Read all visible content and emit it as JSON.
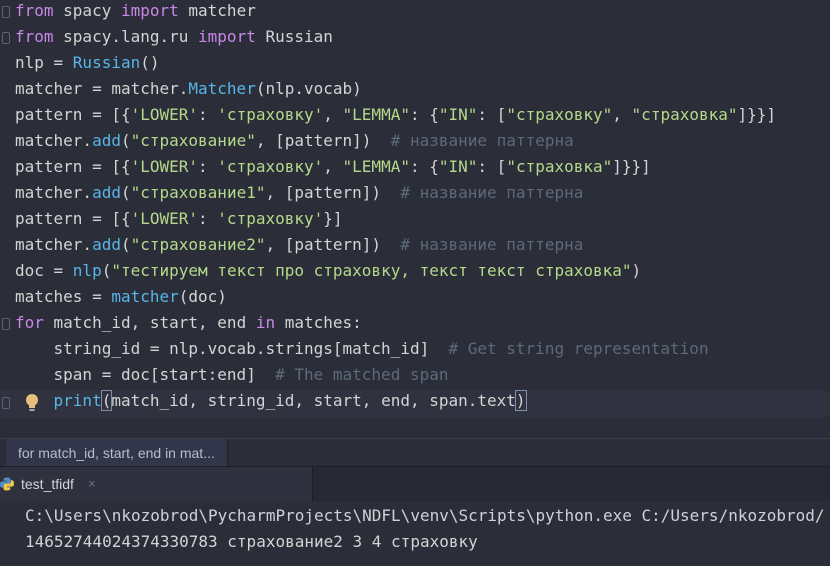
{
  "editor": {
    "lines": [
      [
        {
          "t": "from",
          "c": "kw"
        },
        {
          "t": " spacy ",
          "c": "nm"
        },
        {
          "t": "import",
          "c": "kw"
        },
        {
          "t": " matcher",
          "c": "nm"
        }
      ],
      [
        {
          "t": "from",
          "c": "kw"
        },
        {
          "t": " spacy.lang.ru ",
          "c": "nm"
        },
        {
          "t": "import",
          "c": "kw"
        },
        {
          "t": " Russian",
          "c": "nm"
        }
      ],
      [
        {
          "t": "nlp = ",
          "c": "nm"
        },
        {
          "t": "Russian",
          "c": "fn"
        },
        {
          "t": "()",
          "c": "nm"
        }
      ],
      [
        {
          "t": "matcher = matcher.",
          "c": "nm"
        },
        {
          "t": "Matcher",
          "c": "fn"
        },
        {
          "t": "(nlp.vocab)",
          "c": "nm"
        }
      ],
      [
        {
          "t": "pattern = [{",
          "c": "nm"
        },
        {
          "t": "'LOWER'",
          "c": "st"
        },
        {
          "t": ": ",
          "c": "nm"
        },
        {
          "t": "'страховку'",
          "c": "st"
        },
        {
          "t": ", ",
          "c": "nm"
        },
        {
          "t": "\"LEMMA\"",
          "c": "st"
        },
        {
          "t": ": {",
          "c": "nm"
        },
        {
          "t": "\"IN\"",
          "c": "st"
        },
        {
          "t": ": [",
          "c": "nm"
        },
        {
          "t": "\"страховку\"",
          "c": "st"
        },
        {
          "t": ", ",
          "c": "nm"
        },
        {
          "t": "\"страховка\"",
          "c": "st"
        },
        {
          "t": "]}}]",
          "c": "nm"
        }
      ],
      [
        {
          "t": "matcher.",
          "c": "nm"
        },
        {
          "t": "add",
          "c": "fn"
        },
        {
          "t": "(",
          "c": "nm"
        },
        {
          "t": "\"страхование\"",
          "c": "st"
        },
        {
          "t": ", [pattern])  ",
          "c": "nm"
        },
        {
          "t": "# название паттерна",
          "c": "cm"
        }
      ],
      [
        {
          "t": "pattern = [{",
          "c": "nm"
        },
        {
          "t": "'LOWER'",
          "c": "st"
        },
        {
          "t": ": ",
          "c": "nm"
        },
        {
          "t": "'страховку'",
          "c": "st"
        },
        {
          "t": ", ",
          "c": "nm"
        },
        {
          "t": "\"LEMMA\"",
          "c": "st"
        },
        {
          "t": ": {",
          "c": "nm"
        },
        {
          "t": "\"IN\"",
          "c": "st"
        },
        {
          "t": ": [",
          "c": "nm"
        },
        {
          "t": "\"страховка\"",
          "c": "st"
        },
        {
          "t": "]}}]",
          "c": "nm"
        }
      ],
      [
        {
          "t": "matcher.",
          "c": "nm"
        },
        {
          "t": "add",
          "c": "fn"
        },
        {
          "t": "(",
          "c": "nm"
        },
        {
          "t": "\"страхование1\"",
          "c": "st"
        },
        {
          "t": ", [pattern])  ",
          "c": "nm"
        },
        {
          "t": "# название паттерна",
          "c": "cm"
        }
      ],
      [
        {
          "t": "pattern = [{",
          "c": "nm"
        },
        {
          "t": "'LOWER'",
          "c": "st"
        },
        {
          "t": ": ",
          "c": "nm"
        },
        {
          "t": "'страховку'",
          "c": "st"
        },
        {
          "t": "}]",
          "c": "nm"
        }
      ],
      [
        {
          "t": "matcher.",
          "c": "nm"
        },
        {
          "t": "add",
          "c": "fn"
        },
        {
          "t": "(",
          "c": "nm"
        },
        {
          "t": "\"страхование2\"",
          "c": "st"
        },
        {
          "t": ", [pattern])  ",
          "c": "nm"
        },
        {
          "t": "# название паттерна",
          "c": "cm"
        }
      ],
      [
        {
          "t": "doc = ",
          "c": "nm"
        },
        {
          "t": "nlp",
          "c": "fn"
        },
        {
          "t": "(",
          "c": "nm"
        },
        {
          "t": "\"тестируем текст про страховку, текст текст страховка\"",
          "c": "st"
        },
        {
          "t": ")",
          "c": "nm"
        }
      ],
      [
        {
          "t": "matches = ",
          "c": "nm"
        },
        {
          "t": "matcher",
          "c": "fn"
        },
        {
          "t": "(doc)",
          "c": "nm"
        }
      ],
      [
        {
          "t": "for",
          "c": "kw"
        },
        {
          "t": " match_id, start, end ",
          "c": "nm"
        },
        {
          "t": "in",
          "c": "kw"
        },
        {
          "t": " matches:",
          "c": "nm"
        }
      ],
      [
        {
          "t": "    string_id = nlp.vocab.strings[match_id]  ",
          "c": "nm"
        },
        {
          "t": "# Get string representation",
          "c": "cm"
        }
      ],
      [
        {
          "t": "    span = doc[start:end]  ",
          "c": "nm"
        },
        {
          "t": "# The matched span",
          "c": "cm"
        }
      ],
      [
        {
          "t": "    ",
          "c": "nm"
        },
        {
          "t": "print",
          "c": "fn"
        },
        {
          "t": "(",
          "c": "nm br"
        },
        {
          "t": "match_id, string_id, start, end, span.text",
          "c": "nm"
        },
        {
          "t": ")",
          "c": "nm br"
        }
      ]
    ]
  },
  "breadcrumb": {
    "label": "for match_id, start, end in mat..."
  },
  "run_tab": {
    "label": "test_tfidf",
    "close": "×"
  },
  "console": {
    "line1": "C:\\Users\\nkozobrod\\PycharmProjects\\NDFL\\venv\\Scripts\\python.exe C:/Users/nkozobrod/",
    "line2": "14652744024374330783 страхование2 3 4 страховку"
  },
  "colors": {
    "keyword": "#c987e8",
    "function": "#57b6e8",
    "string": "#b5d98b",
    "comment": "#5d6a7a",
    "text": "#d4d4d4",
    "background": "#2b2d38"
  }
}
